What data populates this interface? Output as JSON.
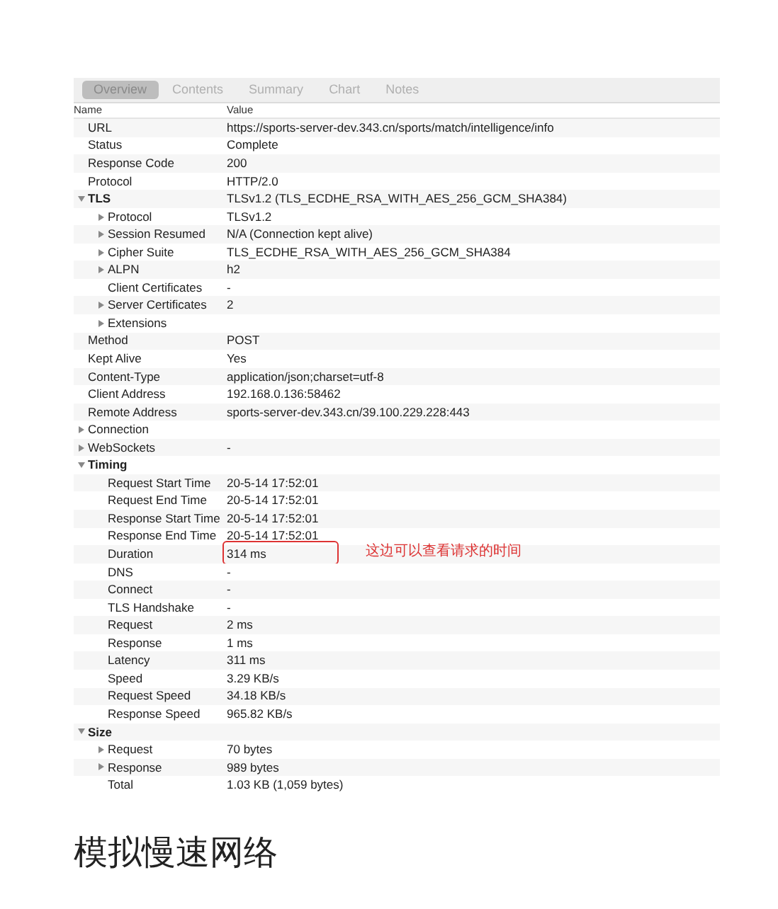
{
  "tabs": [
    {
      "label": "Overview",
      "selected": true
    },
    {
      "label": "Contents",
      "selected": false
    },
    {
      "label": "Summary",
      "selected": false
    },
    {
      "label": "Chart",
      "selected": false
    },
    {
      "label": "Notes",
      "selected": false
    }
  ],
  "columns": [
    "Name",
    "Value"
  ],
  "rows": [
    {
      "name": "URL",
      "value": "https://sports-server-dev.343.cn/sports/match/intelligence/info"
    },
    {
      "name": "Status",
      "value": "Complete"
    },
    {
      "name": "Response Code",
      "value": "200"
    },
    {
      "name": "Protocol",
      "value": "HTTP/2.0"
    },
    {
      "name": "TLS",
      "value": "TLSv1.2 (TLS_ECDHE_RSA_WITH_AES_256_GCM_SHA384)",
      "expanded": true,
      "children": [
        {
          "name": "Protocol",
          "value": "TLSv1.2",
          "expanded": false
        },
        {
          "name": "Session Resumed",
          "value": "N/A (Connection kept alive)",
          "expanded": false
        },
        {
          "name": "Cipher Suite",
          "value": "TLS_ECDHE_RSA_WITH_AES_256_GCM_SHA384",
          "expanded": false
        },
        {
          "name": "ALPN",
          "value": "h2",
          "expanded": false
        },
        {
          "name": "Client Certificates",
          "value": "-"
        },
        {
          "name": "Server Certificates",
          "value": "2",
          "expanded": false
        },
        {
          "name": "Extensions",
          "expanded": false
        }
      ]
    },
    {
      "name": "Method",
      "value": "POST"
    },
    {
      "name": "Kept Alive",
      "value": "Yes"
    },
    {
      "name": "Content-Type",
      "value": "application/json;charset=utf-8"
    },
    {
      "name": "Client Address",
      "value": "192.168.0.136:58462"
    },
    {
      "name": "Remote Address",
      "value": "sports-server-dev.343.cn/39.100.229.228:443"
    },
    {
      "name": "Connection",
      "expanded": false
    },
    {
      "name": "WebSockets",
      "value": "-",
      "expanded": false
    },
    {
      "name": "Timing",
      "expanded": true,
      "children": [
        {
          "name": "Request Start Time",
          "value": "20-5-14 17:52:01"
        },
        {
          "name": "Request End Time",
          "value": "20-5-14 17:52:01"
        },
        {
          "name": "Response Start Time",
          "value": "20-5-14 17:52:01"
        },
        {
          "name": "Response End Time",
          "value": "20-5-14 17:52:01"
        },
        {
          "name": "Duration",
          "value": "314 ms",
          "callout": "这边可以查看请求的时间"
        },
        {
          "name": "DNS",
          "value": "-"
        },
        {
          "name": "Connect",
          "value": "-"
        },
        {
          "name": "TLS Handshake",
          "value": "-"
        },
        {
          "name": "Request",
          "value": "2 ms"
        },
        {
          "name": "Response",
          "value": "1 ms"
        },
        {
          "name": "Latency",
          "value": "311 ms"
        },
        {
          "name": "Speed",
          "value": "3.29 KB/s"
        },
        {
          "name": "Request Speed",
          "value": "34.18 KB/s"
        },
        {
          "name": "Response Speed",
          "value": "965.82 KB/s"
        }
      ]
    },
    {
      "name": "Size",
      "expanded": true,
      "children": [
        {
          "name": "Request",
          "value": "70 bytes",
          "expanded": false
        },
        {
          "name": "Response",
          "value": "989 bytes",
          "expanded": false
        },
        {
          "name": "Total",
          "value": "1.03 KB (1,059 bytes)"
        }
      ]
    }
  ],
  "heading": "模拟慢速网络"
}
